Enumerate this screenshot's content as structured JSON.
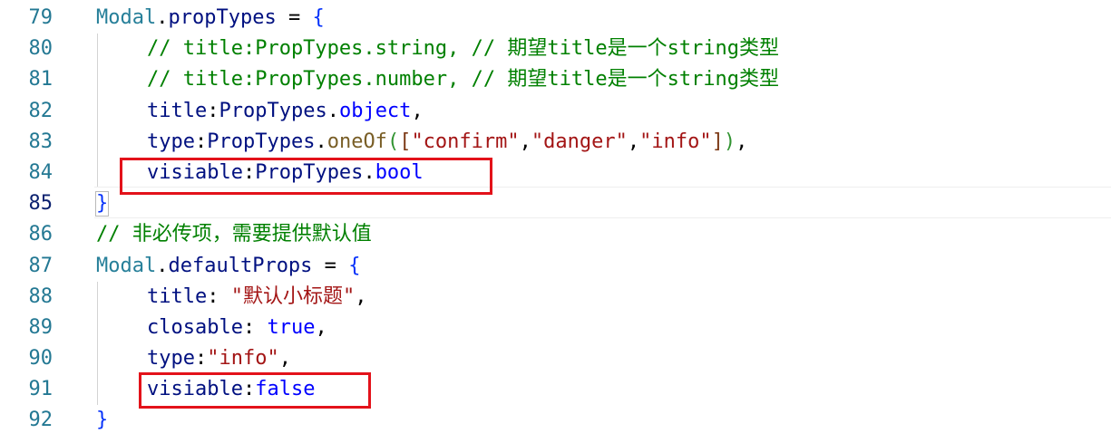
{
  "editor": {
    "lines": [
      {
        "num": "79",
        "tokens": [
          {
            "t": "Modal",
            "c": "c-ident"
          },
          {
            "t": ".",
            "c": "c-punc"
          },
          {
            "t": "propTypes",
            "c": "c-prop"
          },
          {
            "t": " = ",
            "c": "c-punc"
          },
          {
            "t": "{",
            "c": "c-brace"
          }
        ]
      },
      {
        "num": "80",
        "indent": 1,
        "tokens": [
          {
            "t": "// title:PropTypes.string, // 期望title是一个string类型",
            "c": "c-comment"
          }
        ]
      },
      {
        "num": "81",
        "indent": 1,
        "tokens": [
          {
            "t": "// title:PropTypes.number, // 期望title是一个string类型",
            "c": "c-comment"
          }
        ]
      },
      {
        "num": "82",
        "indent": 1,
        "tokens": [
          {
            "t": "title",
            "c": "c-prop"
          },
          {
            "t": ":",
            "c": "c-punc"
          },
          {
            "t": "PropTypes",
            "c": "c-prop"
          },
          {
            "t": ".",
            "c": "c-punc"
          },
          {
            "t": "object",
            "c": "c-kw"
          },
          {
            "t": ",",
            "c": "c-punc"
          }
        ]
      },
      {
        "num": "83",
        "indent": 1,
        "tokens": [
          {
            "t": "type",
            "c": "c-prop"
          },
          {
            "t": ":",
            "c": "c-punc"
          },
          {
            "t": "PropTypes",
            "c": "c-prop"
          },
          {
            "t": ".",
            "c": "c-punc"
          },
          {
            "t": "oneOf",
            "c": "c-method"
          },
          {
            "t": "(",
            "c": "c-paren"
          },
          {
            "t": "[",
            "c": "c-bracket"
          },
          {
            "t": "\"confirm\"",
            "c": "c-string"
          },
          {
            "t": ",",
            "c": "c-punc"
          },
          {
            "t": "\"danger\"",
            "c": "c-string"
          },
          {
            "t": ",",
            "c": "c-punc"
          },
          {
            "t": "\"info\"",
            "c": "c-string"
          },
          {
            "t": "]",
            "c": "c-bracket"
          },
          {
            "t": ")",
            "c": "c-paren"
          },
          {
            "t": ",",
            "c": "c-punc"
          }
        ]
      },
      {
        "num": "84",
        "indent": 1,
        "tokens": [
          {
            "t": "visiable",
            "c": "c-prop"
          },
          {
            "t": ":",
            "c": "c-punc"
          },
          {
            "t": "PropTypes",
            "c": "c-prop"
          },
          {
            "t": ".",
            "c": "c-punc"
          },
          {
            "t": "bool",
            "c": "c-kw"
          }
        ]
      },
      {
        "num": "85",
        "current": true,
        "tokens": [
          {
            "t": "}",
            "c": "c-brace",
            "boxed": true
          }
        ]
      },
      {
        "num": "86",
        "tokens": [
          {
            "t": "// 非必传项，需要提供默认值",
            "c": "c-comment"
          }
        ]
      },
      {
        "num": "87",
        "tokens": [
          {
            "t": "Modal",
            "c": "c-ident"
          },
          {
            "t": ".",
            "c": "c-punc"
          },
          {
            "t": "defaultProps",
            "c": "c-prop"
          },
          {
            "t": " = ",
            "c": "c-punc"
          },
          {
            "t": "{",
            "c": "c-brace"
          }
        ]
      },
      {
        "num": "88",
        "indent": 1,
        "tokens": [
          {
            "t": "title",
            "c": "c-prop"
          },
          {
            "t": ": ",
            "c": "c-punc"
          },
          {
            "t": "\"默认小标题\"",
            "c": "c-string"
          },
          {
            "t": ",",
            "c": "c-punc"
          }
        ]
      },
      {
        "num": "89",
        "indent": 1,
        "tokens": [
          {
            "t": "closable",
            "c": "c-prop"
          },
          {
            "t": ": ",
            "c": "c-punc"
          },
          {
            "t": "true",
            "c": "c-bool"
          },
          {
            "t": ",",
            "c": "c-punc"
          }
        ]
      },
      {
        "num": "90",
        "indent": 1,
        "tokens": [
          {
            "t": "type",
            "c": "c-prop"
          },
          {
            "t": ":",
            "c": "c-punc"
          },
          {
            "t": "\"info\"",
            "c": "c-string"
          },
          {
            "t": ",",
            "c": "c-punc"
          }
        ]
      },
      {
        "num": "91",
        "indent": 1,
        "tokens": [
          {
            "t": "visiable",
            "c": "c-prop"
          },
          {
            "t": ":",
            "c": "c-punc"
          },
          {
            "t": "false",
            "c": "c-bool"
          }
        ]
      },
      {
        "num": "92",
        "tokens": [
          {
            "t": "}",
            "c": "c-brace"
          }
        ]
      }
    ],
    "annotations": [
      {
        "line": "84",
        "color": "#e3121a"
      },
      {
        "line": "91",
        "color": "#e3121a"
      }
    ]
  }
}
